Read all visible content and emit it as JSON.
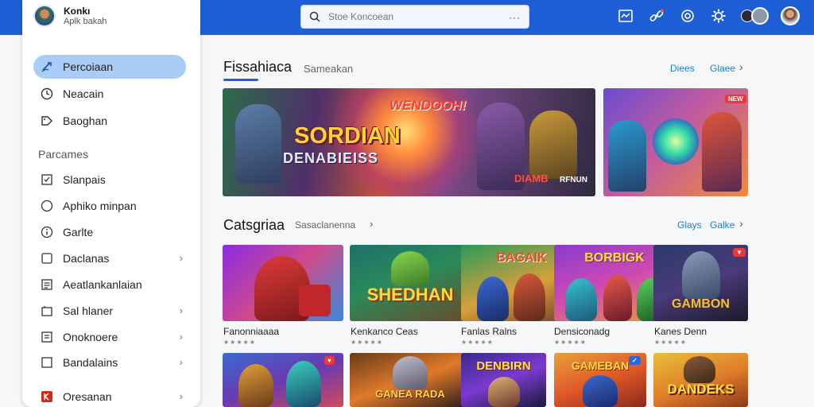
{
  "header": {
    "search_placeholder": "Stoe Koncoean",
    "menu_dots": "···"
  },
  "sidebar": {
    "profile": {
      "name": "Konkı",
      "subtitle": "Aplk bakah"
    },
    "items": [
      {
        "label": "Percoiaan",
        "icon": "controller-icon",
        "active": true
      },
      {
        "label": "Neacain",
        "icon": "clock-icon"
      },
      {
        "label": "Baoghan",
        "icon": "tag-icon"
      }
    ],
    "section_label": "Parcames",
    "section_items": [
      {
        "label": "Slanpais",
        "icon": "checkbox-icon"
      },
      {
        "label": "Aphiko minpan",
        "icon": "circle-icon"
      },
      {
        "label": "Garlte",
        "icon": "info-icon"
      },
      {
        "label": "Daclanas",
        "icon": "square-icon",
        "chevron": "›"
      },
      {
        "label": "Aeatlankanlaian",
        "icon": "list-icon"
      },
      {
        "label": "Sal hlaner",
        "icon": "bag-icon",
        "chevron": "›"
      },
      {
        "label": "Onoknoere",
        "icon": "document-icon",
        "chevron": "›"
      },
      {
        "label": "Bandalains",
        "icon": "square-icon",
        "chevron": "›"
      },
      {
        "label": "Oresanan",
        "icon": "red-app-icon",
        "chevron": "›"
      }
    ]
  },
  "featured": {
    "title": "Fissahiaca",
    "subtitle": "Sameakan",
    "link1": "Diees",
    "link2": "Glaee",
    "arrow": "›",
    "hero_main": {
      "top": "WENDOOH!",
      "big": "SORDIAN",
      "sub": "DENABIEISS",
      "corner": "DIAMB",
      "corner2": "RFNUN"
    },
    "hero_side_badge": "NEW"
  },
  "categories": {
    "title": "Catsgriaa",
    "subtitle": "Sasaclanenna",
    "arrow": "›",
    "link1": "Glays",
    "link2": "Galke"
  },
  "games_row1": [
    {
      "name": "Fanonniaaaa",
      "rating": "★★★★★",
      "art": ""
    },
    {
      "name": "Kenkanco Ceas",
      "rating": "★★★★★",
      "art": "SHEDHAN"
    },
    {
      "name": "Fanlas Ralns",
      "rating": "★★★★★",
      "art": "BAGAIK"
    },
    {
      "name": "Densiconadg",
      "rating": "★★★★★",
      "art": "BORBIGK"
    },
    {
      "name": "Kanes Denn",
      "rating": "★★★★★",
      "art": "GAMBON"
    }
  ],
  "games_row2": [
    {
      "art": ""
    },
    {
      "art": "GANEA RADA"
    },
    {
      "art": "DENBIRN"
    },
    {
      "art": "GAMEBAN"
    },
    {
      "art": "DANDEKS"
    }
  ],
  "colors": {
    "accent": "#1e5fd8",
    "active_nav": "#a9cdf6",
    "link": "#1e7fc2"
  }
}
